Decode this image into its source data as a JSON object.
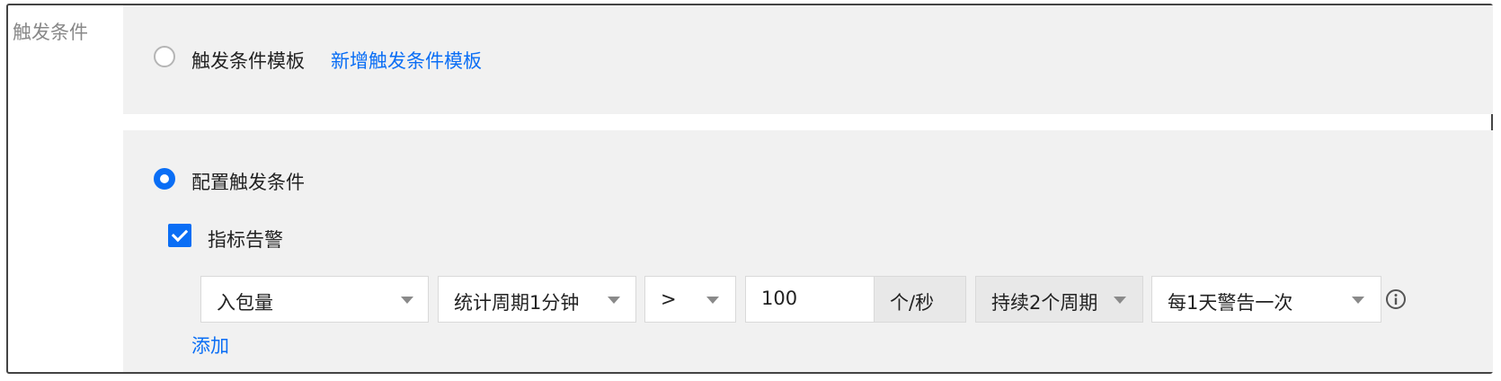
{
  "section": {
    "label": "触发条件"
  },
  "template_option": {
    "label": "触发条件模板",
    "add_link": "新增触发条件模板",
    "selected": false
  },
  "config_option": {
    "label": "配置触发条件",
    "selected": true
  },
  "metric_alarm": {
    "label": "指标告警",
    "checked": true,
    "rule": {
      "metric": "入包量",
      "period": "统计周期1分钟",
      "operator": ">",
      "threshold": "100",
      "unit": "个/秒",
      "duration": "持续2个周期",
      "frequency": "每1天警告一次"
    },
    "add_link": "添加"
  },
  "colors": {
    "accent": "#0a6ef5",
    "panel_bg": "#f1f1f1"
  },
  "icons": {
    "info": "info-circle-icon",
    "caret": "chevron-down-icon"
  }
}
